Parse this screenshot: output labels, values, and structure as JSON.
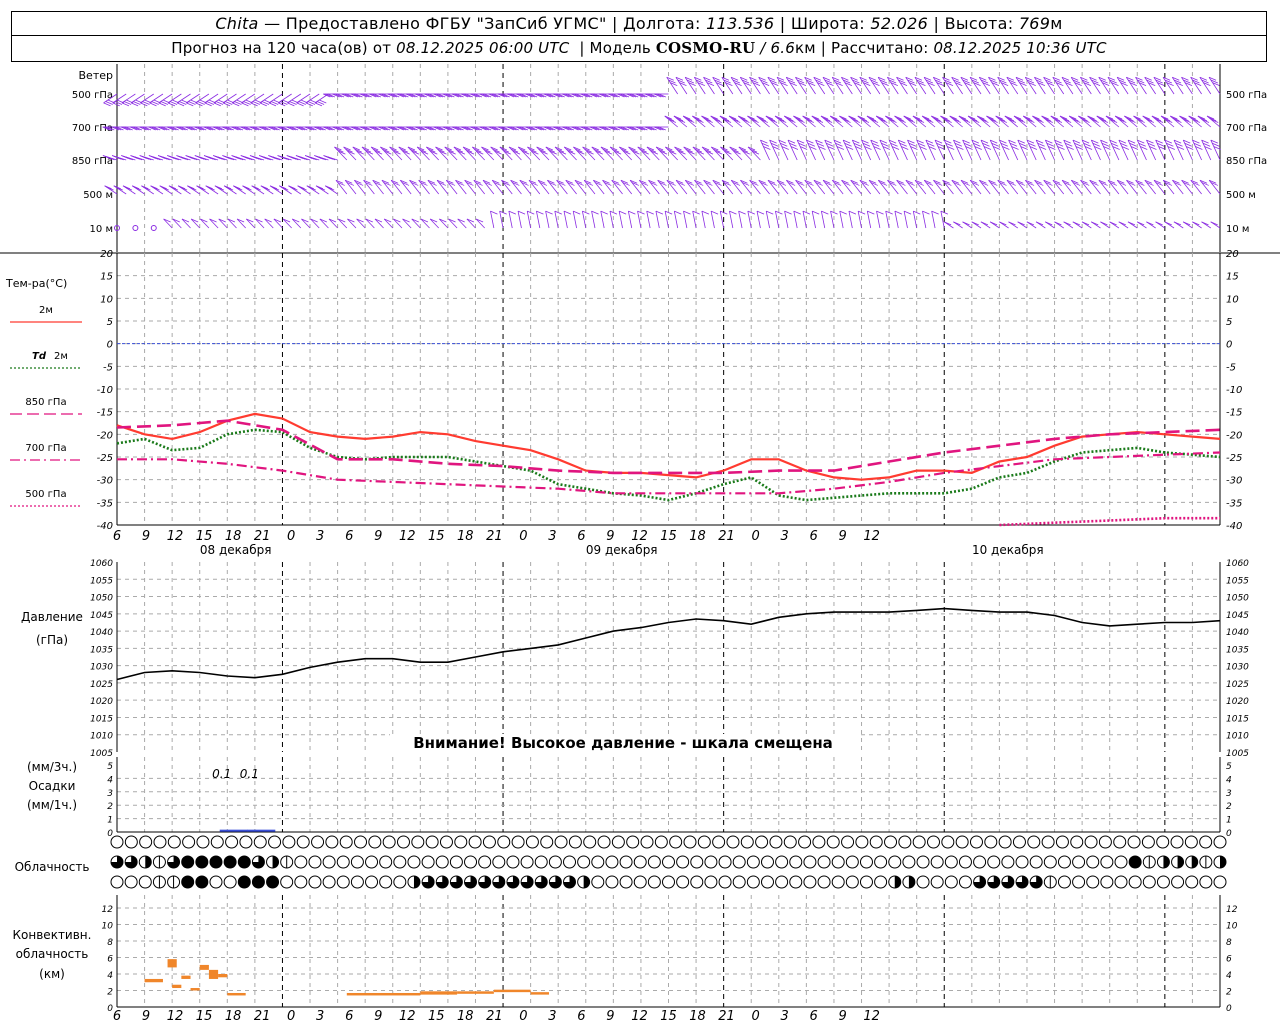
{
  "header": {
    "station": "Chita",
    "dash": "—",
    "provider": "Предоставлено ФГБУ \"ЗапСиб УГМС\"",
    "lon_label": "Долгота:",
    "lon_value": "113.536",
    "lat_label": "Широта:",
    "lat_value": "52.026",
    "alt_label": "Высота:",
    "alt_value": "769",
    "alt_unit": "м",
    "sep": "|",
    "forecast_label": "Прогноз на 120 часа(ов) от",
    "forecast_time": "08.12.2025 06:00 UTC",
    "model_label": "Модель",
    "model_name": "COSMO-RU",
    "model_res": "/ 6.6",
    "model_res_unit": "км",
    "calc_label": "Рассчитано:",
    "calc_time": "08.12.2025 10:36 UTC"
  },
  "wind_panel": {
    "title": "Ветер",
    "levels": [
      "500 гПа",
      "700 гПа",
      "850 гПа",
      "500 м",
      "10 м"
    ],
    "color": "#8a2be2"
  },
  "time_axis": {
    "tick_labels": [
      "6",
      "9",
      "12",
      "15",
      "18",
      "21",
      "0",
      "3",
      "6",
      "9",
      "12",
      "15",
      "18",
      "21",
      "0",
      "3",
      "6",
      "9",
      "12",
      "15",
      "18",
      "21",
      "0",
      "3",
      "6",
      "9",
      "12"
    ],
    "day_labels": [
      "08 декабря",
      "09 декабря",
      "10 декабря"
    ]
  },
  "temperature_panel": {
    "title": "Тем-ра(°С)",
    "legend": [
      {
        "label": "2м",
        "color": "#ff3b30",
        "style": "solid"
      },
      {
        "label": "Td",
        "label2": "2м",
        "color": "#1a7a1a",
        "style": "dotted"
      },
      {
        "label": "850 гПа",
        "color": "#e0157f",
        "style": "long-dash"
      },
      {
        "label": "700 гПа",
        "color": "#e0157f",
        "style": "dash-dot"
      },
      {
        "label": "500 гПа",
        "color": "#e0157f",
        "style": "dotted"
      }
    ],
    "y_ticks": [
      "20",
      "15",
      "10",
      "5",
      "0",
      "-5",
      "-10",
      "-15",
      "-20",
      "-25",
      "-30",
      "-35",
      "-40"
    ]
  },
  "pressure_panel": {
    "title": "Давление",
    "unit": "(гПа)",
    "y_ticks": [
      "1060",
      "1055",
      "1050",
      "1045",
      "1040",
      "1035",
      "1030",
      "1025",
      "1020",
      "1015",
      "1010",
      "1005"
    ],
    "warning": "Внимание! Высокое давление - шкала смещена"
  },
  "precip_panel": {
    "unit_3h": "(мм/3ч.)",
    "title": "Осадки",
    "unit_1h": "(мм/1ч.)",
    "y_ticks": [
      "5",
      "4",
      "3",
      "2",
      "1",
      "0"
    ],
    "labels": [
      {
        "hour": 9,
        "text": "0.1"
      },
      {
        "hour": 12,
        "text": "0.1"
      }
    ]
  },
  "cloud_panel": {
    "title": "Облачность"
  },
  "convective_panel": {
    "title_1": "Конвективн.",
    "title_2": "облачность",
    "unit": "(км)",
    "y_ticks": [
      "12",
      "10",
      "8",
      "6",
      "4",
      "2",
      "0"
    ],
    "color": "#f0862a"
  },
  "chart_data": {
    "type": "line",
    "x_unit": "hours since 08.12.2025 06:00 UTC",
    "series": [
      {
        "name": "2м",
        "panel": "temperature",
        "x": [
          0,
          3,
          6,
          9,
          12,
          15,
          18,
          21,
          24,
          27,
          30,
          33,
          36,
          39,
          42,
          45,
          48,
          51,
          54,
          57,
          60,
          63,
          66,
          69,
          72,
          75,
          78,
          81,
          84,
          87,
          90,
          93,
          96,
          99,
          102,
          105,
          108,
          111,
          114,
          117,
          120
        ],
        "y": [
          -18,
          -20,
          -21,
          -19.5,
          -17,
          -15.5,
          -16.5,
          -19.5,
          -20.5,
          -21,
          -20.5,
          -19.5,
          -20,
          -21.5,
          -22.5,
          -23.5,
          -25.5,
          -28,
          -28.5,
          -28.5,
          -29,
          -29.5,
          -28,
          -25.5,
          -25.5,
          -28,
          -29.5,
          -30,
          -29.5,
          -28,
          -28,
          -28.5,
          -26,
          -25,
          -22.5,
          -20.5,
          -20,
          -19.5,
          -20,
          -20.5,
          -21
        ]
      },
      {
        "name": "Td 2м",
        "panel": "temperature",
        "x": [
          0,
          3,
          6,
          9,
          12,
          15,
          18,
          21,
          24,
          27,
          30,
          33,
          36,
          39,
          42,
          45,
          48,
          51,
          54,
          57,
          60,
          63,
          66,
          69,
          72,
          75,
          78,
          81,
          84,
          87,
          90,
          93,
          96,
          99,
          102,
          105,
          108,
          111,
          114,
          117,
          120
        ],
        "y": [
          -22,
          -21,
          -23.5,
          -23,
          -20,
          -19,
          -19.5,
          -23,
          -25,
          -25.5,
          -25,
          -25,
          -25,
          -26,
          -27,
          -28,
          -31,
          -32,
          -33,
          -33.5,
          -34.5,
          -33,
          -31,
          -29.5,
          -33.5,
          -34.5,
          -34,
          -33.5,
          -33,
          -33,
          -33,
          -32,
          -29.5,
          -28.5,
          -26,
          -24,
          -23.5,
          -23,
          -24,
          -24.5,
          -25
        ]
      },
      {
        "name": "850 гПа",
        "panel": "temperature",
        "x": [
          0,
          6,
          12,
          18,
          24,
          30,
          36,
          42,
          48,
          54,
          60,
          66,
          72,
          78,
          84,
          90,
          96,
          102,
          108,
          114,
          120
        ],
        "y": [
          -18.5,
          -18,
          -17,
          -19,
          -25.5,
          -25.5,
          -26.5,
          -27,
          -28,
          -28.5,
          -28.5,
          -28.5,
          -28,
          -28,
          -26,
          -24,
          -22.5,
          -21,
          -20,
          -19.5,
          -19
        ]
      },
      {
        "name": "700 гПа",
        "panel": "temperature",
        "x": [
          0,
          6,
          12,
          18,
          24,
          30,
          36,
          42,
          48,
          54,
          60,
          66,
          72,
          78,
          84,
          90,
          96,
          102,
          108,
          114,
          120
        ],
        "y": [
          -25.5,
          -25.5,
          -26.5,
          -28,
          -30,
          -30.5,
          -31,
          -31.5,
          -32,
          -33,
          -33,
          -33,
          -33,
          -32,
          -30.5,
          -28.5,
          -27,
          -25.5,
          -25,
          -24.5,
          -24
        ]
      },
      {
        "name": "500 гПа",
        "panel": "temperature",
        "x": [
          96,
          102,
          108,
          114,
          120
        ],
        "y": [
          -40,
          -39.5,
          -39,
          -38.5,
          -38.5
        ]
      },
      {
        "name": "Давление",
        "panel": "pressure",
        "x": [
          0,
          3,
          6,
          9,
          12,
          15,
          18,
          21,
          24,
          27,
          30,
          33,
          36,
          39,
          42,
          45,
          48,
          51,
          54,
          57,
          60,
          63,
          66,
          69,
          72,
          75,
          78,
          81,
          84,
          87,
          90,
          93,
          96,
          99,
          102,
          105,
          108,
          111,
          114,
          117,
          120
        ],
        "y": [
          1026,
          1028,
          1028.5,
          1028,
          1027,
          1026.5,
          1027.5,
          1029.5,
          1031,
          1032,
          1032,
          1031,
          1031,
          1032.5,
          1034,
          1035,
          1036,
          1038,
          1040,
          1041,
          1042.5,
          1043.5,
          1043,
          1042,
          1044,
          1045,
          1045.5,
          1045.5,
          1045.5,
          1046,
          1046.5,
          1046,
          1045.5,
          1045.5,
          1044.5,
          1042.5,
          1041.5,
          1042,
          1042.5,
          1042.5,
          1043
        ]
      },
      {
        "name": "Осадки",
        "panel": "precipitation",
        "x": [
          9,
          12
        ],
        "y": [
          0.1,
          0.1
        ]
      }
    ],
    "convective": [
      {
        "x0": 3,
        "x1": 5,
        "base": 3,
        "top": 3.4
      },
      {
        "x0": 5.5,
        "x1": 6.5,
        "base": 4.8,
        "top": 5.8
      },
      {
        "x0": 6,
        "x1": 7,
        "base": 2.3,
        "top": 2.7
      },
      {
        "x0": 7,
        "x1": 8,
        "base": 3.4,
        "top": 3.8
      },
      {
        "x0": 8,
        "x1": 9,
        "base": 2.0,
        "top": 2.3
      },
      {
        "x0": 9,
        "x1": 10,
        "base": 4.5,
        "top": 5.1
      },
      {
        "x0": 10,
        "x1": 11,
        "base": 3.4,
        "top": 4.5
      },
      {
        "x0": 11,
        "x1": 12,
        "base": 3.6,
        "top": 4.0
      },
      {
        "x0": 12,
        "x1": 14,
        "base": 1.4,
        "top": 1.7
      },
      {
        "x0": 25,
        "x1": 33,
        "base": 1.4,
        "top": 1.7
      },
      {
        "x0": 33,
        "x1": 37,
        "base": 1.5,
        "top": 1.9
      },
      {
        "x0": 37,
        "x1": 41,
        "base": 1.6,
        "top": 1.9
      },
      {
        "x0": 41,
        "x1": 45,
        "base": 1.8,
        "top": 2.1
      },
      {
        "x0": 45,
        "x1": 47,
        "base": 1.5,
        "top": 1.8
      }
    ],
    "cloud_rows": {
      "upper": "000000000000000000000000000000000000000000000000000000000000000000000000000000",
      "middle": "3321344444321000000000000000000000000000000000000000000000000000000000004122212",
      "lower": "0001144004440000000002333333333332000000000000000000000220000333331000000000000"
    }
  }
}
